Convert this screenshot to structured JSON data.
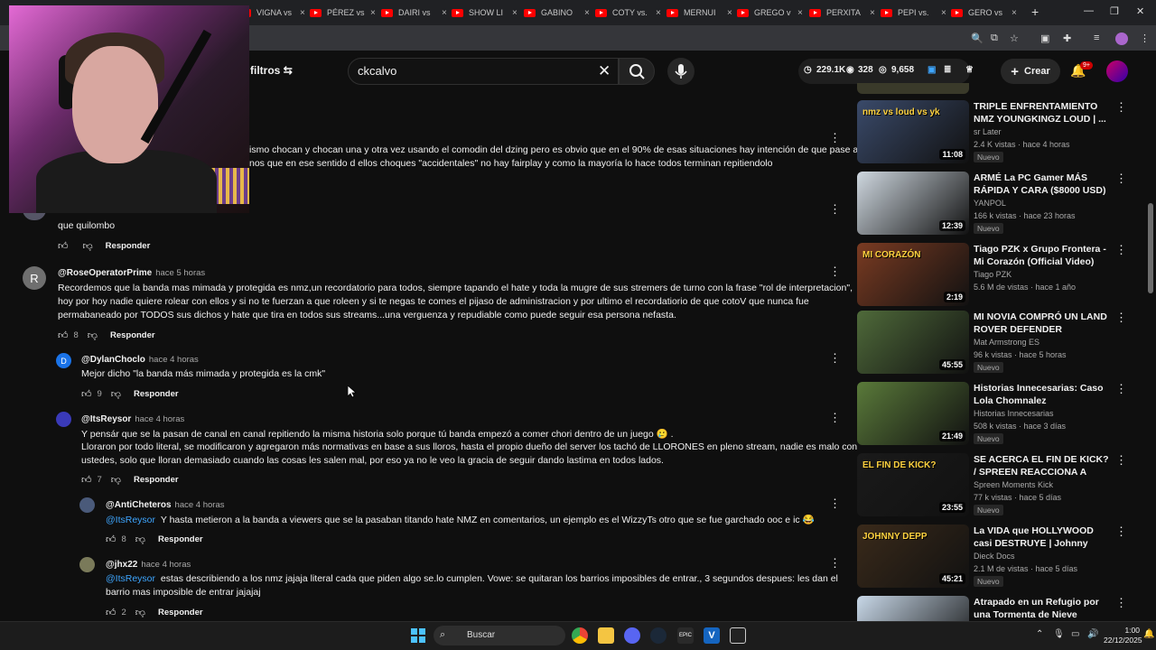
{
  "browser": {
    "tabs": [
      {
        "label": "VIGNA vs"
      },
      {
        "label": "PÉREZ vs"
      },
      {
        "label": "DAIRI vs"
      },
      {
        "label": "SHOW LI"
      },
      {
        "label": "GABINO"
      },
      {
        "label": "COTY vs."
      },
      {
        "label": "MERNUI"
      },
      {
        "label": "GREGO v"
      },
      {
        "label": "PERXITA"
      },
      {
        "label": "PEPI vs."
      },
      {
        "label": "GERO vs"
      }
    ],
    "new_tab": "+",
    "close_tab": "×",
    "minimize": "—",
    "maximize": "❐",
    "close_window": "✕"
  },
  "header": {
    "filters_label": "filtros",
    "search_value": "ckcalvo",
    "stats": [
      "229.1K",
      "328",
      "9,658"
    ],
    "create_label": "Crear",
    "notif_count": "9+"
  },
  "comments": {
    "partial_line1": "ismo chocan y chocan una y otra vez usando el comodin del dzing pero es obvio que en el 90% de esas situaciones hay intención de que pase algo",
    "partial_line2": "nos que en ese sentido d ellos choques \"accidentales\" no hay fairplay y como la mayoría lo hace todos terminan repitiendolo",
    "prev_text": "que quilombo",
    "reply_label": "Responder",
    "items": [
      {
        "author": "@RoseOperatorPrime",
        "time": "hace 5 horas",
        "avatar_letter": "R",
        "lines": [
          "Recordemos que la banda mas mimada y protegida es nmz,un recordatorio para todos, siempre tapando el hate y toda la mugre de sus stremers de turno con la frase \"rol de interpretacion\",",
          "hoy por hoy nadie quiere rolear con ellos y si no te fuerzan a que roleen y si te negas te comes el pijaso de administracion y por ultimo el recordatiorio de que cotoV que nunca fue",
          "permabaneado por TODOS sus dichos y hate que tira en todos sus streams...una verguenza y repudiable como puede seguir esa persona nefasta."
        ],
        "likes": "8"
      },
      {
        "author": "@DylanChoclo",
        "time": "hace 4 horas",
        "avatar_letter": "D",
        "lines": [
          "Mejor dicho \"la banda más mimada y protegida es la cmk\""
        ],
        "likes": "9"
      },
      {
        "author": "@ItsReysor",
        "time": "hace 4 horas",
        "lines": [
          "Y pensár que se la pasan de canal en canal repitiendo la misma historia solo porque tú banda empezó a comer chori dentro de un juego 🥲 .",
          "Lloraron por todo literal, se modificaron y agregaron más normativas en base a sus lloros, hasta el propio dueño del server los tachó de LLORONES en pleno stream, nadie es malo con",
          "ustedes, solo que lloran demasiado cuando las cosas les salen mal,  por eso ya no le veo la gracia de seguir dando lastima en todos lados."
        ],
        "likes": "7"
      },
      {
        "author": "@AntiCheteros",
        "time": "hace 4 horas",
        "mention": "@ItsReysor",
        "lines": [
          "Y hasta metieron a la banda a viewers que se la pasaban titando hate NMZ en comentarios, un ejemplo es el WizzyTs otro que se fue garchado ooc e ic 😂"
        ],
        "likes": "8"
      },
      {
        "author": "@jhx22",
        "time": "hace 4 horas",
        "mention": "@ItsReysor",
        "lines": [
          "estas describiendo a los nmz  jajaja literal cada que piden algo se.lo cumplen. Vowe: se quitaran los barrios imposibles de entrar., 3 segundos despues: les dan el",
          "barrio mas imposible de entrar jajajaj"
        ],
        "likes": "2"
      }
    ]
  },
  "sidebar_videos": [
    {
      "title": "TRIPLE ENFRENTAMIENTO NMZ YOUNGKINGZ LOUD | ...",
      "channel": "sr Later",
      "meta": "2.4 K vistas · hace 4 horas",
      "badge": "Nuevo",
      "duration": "11:08",
      "thumb_color": "#3a4a6a",
      "thumb_text": "nmz vs loud vs yk"
    },
    {
      "title": "ARMÉ La PC Gamer MÁS RÁPIDA Y CARA ($8000 USD)",
      "channel": "YANPOL",
      "meta": "166 k vistas · hace 23 horas",
      "badge": "Nuevo",
      "duration": "12:39",
      "thumb_color": "#cfd8e0",
      "thumb_text": ""
    },
    {
      "title": "Tiago PZK x Grupo Frontera - Mi Corazón (Official Video)",
      "channel": "Tiago PZK",
      "meta": "5.6 M de vistas · hace 1 año",
      "badge": "",
      "duration": "2:19",
      "thumb_color": "#7a3b22",
      "thumb_text": "MI CORAZÓN"
    },
    {
      "title": "MI NOVIA COMPRÓ UN LAND ROVER DEFENDER DESTRUIDO",
      "channel": "Mat Armstrong ES",
      "meta": "96 k vistas · hace 5 horas",
      "badge": "Nuevo",
      "duration": "45:55",
      "thumb_color": "#4f6a3a",
      "thumb_text": ""
    },
    {
      "title": "Historias Innecesarias: Caso Lola Chomnalez",
      "channel": "Historias Innecesarias",
      "meta": "508 k vistas · hace 3 días",
      "badge": "Nuevo",
      "duration": "21:49",
      "thumb_color": "#5a7a3a",
      "thumb_text": ""
    },
    {
      "title": "SE ACERCA EL FIN DE KICK? / SPREEN REACCIONA A VIDEO ...",
      "channel": "Spreen Moments Kick",
      "meta": "77 k vistas · hace 5 días",
      "badge": "Nuevo",
      "duration": "23:55",
      "thumb_color": "#1a1a1a",
      "thumb_text": "EL FIN DE KICK?"
    },
    {
      "title": "La VIDA que HOLLYWOOD casi DESTRUYE | Johnny Depp | ...",
      "channel": "Dieck Docs",
      "meta": "2.1 M de vistas · hace 5 días",
      "badge": "Nuevo",
      "duration": "45:21",
      "thumb_color": "#3a2a1a",
      "thumb_text": "JOHNNY DEPP"
    },
    {
      "title": "Atrapado en un Refugio por una Tormenta de Nieve",
      "channel": "",
      "meta": "",
      "badge": "",
      "duration": "",
      "thumb_color": "#c8d8e8",
      "thumb_text": ""
    }
  ],
  "taskbar": {
    "search_label": "Buscar",
    "time": "1:00",
    "date": "22/12/2025"
  }
}
